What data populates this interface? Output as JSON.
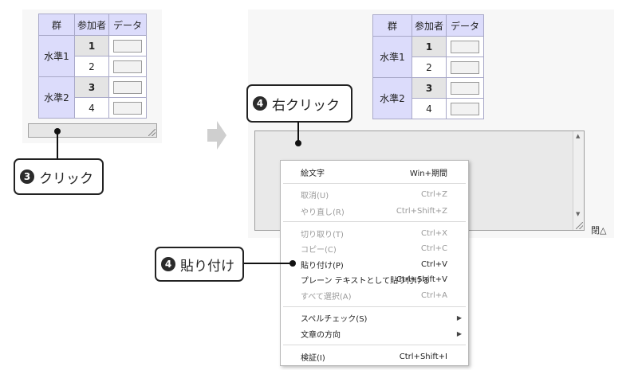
{
  "table": {
    "headers": [
      "群",
      "参加者",
      "データ"
    ],
    "levels": [
      "水準1",
      "水準2"
    ],
    "participants": [
      "1",
      "2",
      "3",
      "4"
    ]
  },
  "callouts": {
    "click": {
      "num": "3",
      "text": "クリック"
    },
    "right_click": {
      "num": "4",
      "text": "右クリック"
    },
    "paste": {
      "num": "4",
      "text": "貼り付け"
    }
  },
  "close_label": "閉△",
  "context_menu": {
    "emoji": {
      "label": "絵文字",
      "shortcut": "Win+期間"
    },
    "undo": {
      "label": "取消(U)",
      "shortcut": "Ctrl+Z"
    },
    "redo": {
      "label": "やり直し(R)",
      "shortcut": "Ctrl+Shift+Z"
    },
    "cut": {
      "label": "切り取り(T)",
      "shortcut": "Ctrl+X"
    },
    "copy": {
      "label": "コピー(C)",
      "shortcut": "Ctrl+C"
    },
    "paste": {
      "label": "貼り付け(P)",
      "shortcut": "Ctrl+V"
    },
    "paste_plain": {
      "label": "プレーン テキストとして貼り付ける",
      "shortcut": "Ctrl+Shift+V"
    },
    "select_all": {
      "label": "すべて選択(A)",
      "shortcut": "Ctrl+A"
    },
    "spellcheck": {
      "label": "スペルチェック(S)"
    },
    "direction": {
      "label": "文章の方向"
    },
    "inspect": {
      "label": "検証(I)",
      "shortcut": "Ctrl+Shift+I"
    }
  },
  "icons": {
    "arrow": "right-arrow-icon",
    "scroll_up": "chevron-up-icon",
    "scroll_down": "chevron-down-icon"
  }
}
